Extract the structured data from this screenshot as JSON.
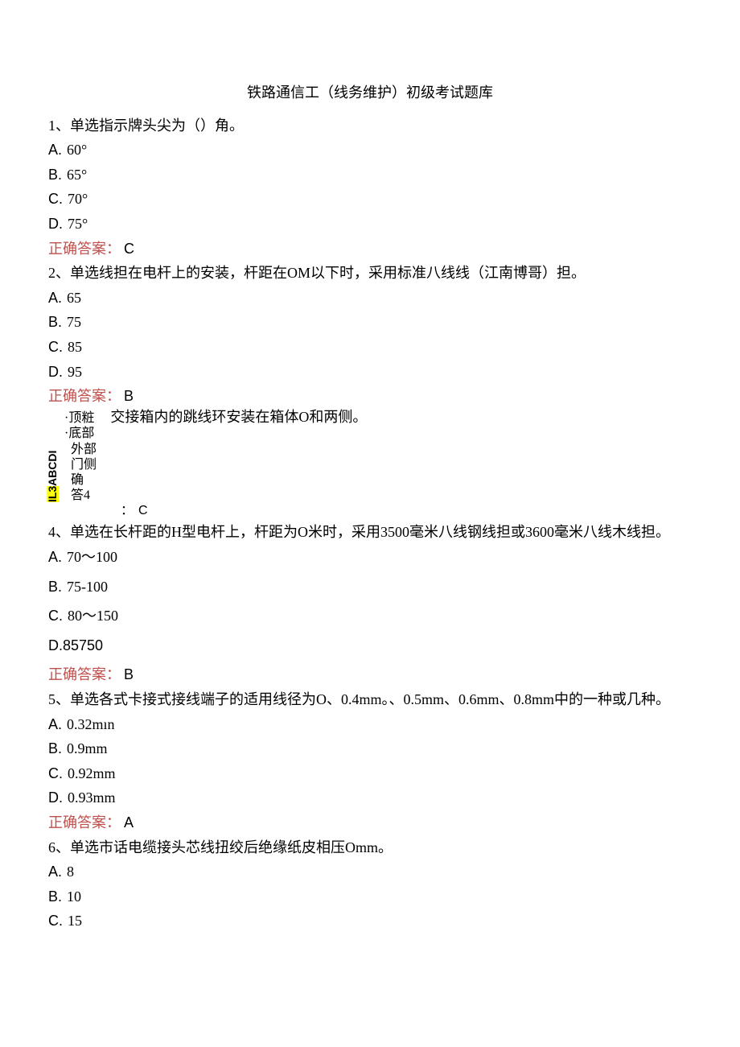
{
  "title": "铁路通信工（线务维护）初级考试题库",
  "q1": {
    "text": "1、单选指示牌头尖为（）角。",
    "a": "60°",
    "b": "65°",
    "c": "70°",
    "d": "75°",
    "answer_label": "正确答案：",
    "answer": "C"
  },
  "q2": {
    "text": "2、单选线担在电杆上的安装，杆距在OM以下时，采用标准八线线（江南博哥）担。",
    "a": "65",
    "b": "75",
    "c": "85",
    "d": "95",
    "answer_label": "正确答案：",
    "answer": "B"
  },
  "q3": {
    "rotated": "IL3ABCDI",
    "rot_side": "·顶粧\n·底部\n  外部\n  门侧\n  确\n  答4\n  ：",
    "right1_bullet": "·顶粧",
    "right1_text": "    交接箱内的跳线环安装在箱体O和两侧。",
    "right2": "·底部",
    "right3": "  外部",
    "right4": "  门侧",
    "right5": "  确",
    "right6": "  答4",
    "colon": "：",
    "answer": "C"
  },
  "q4": {
    "text": "4、单选在长杆距的H型电杆上，杆距为O米时，采用3500毫米八线钢线担或3600毫米八线木线担。",
    "a": "70～100",
    "b": "75-100",
    "c": "80～150",
    "d": "D.85750",
    "answer_label": "正确答案：",
    "answer": "B"
  },
  "q5": {
    "text": "5、单选各式卡接式接线端子的适用线径为O、0.4mm。、0.5mm、0.6mm、0.8mm中的一种或几种。",
    "a": "0.32mın",
    "b": "0.9mm",
    "c": "0.92mm",
    "d": "0.93mm",
    "answer_label": "正确答案：",
    "answer": "A"
  },
  "q6": {
    "text": "6、单选市话电缆接头芯线扭绞后绝缘纸皮相压Omm。",
    "a": "8",
    "b": "10",
    "c": "15"
  }
}
